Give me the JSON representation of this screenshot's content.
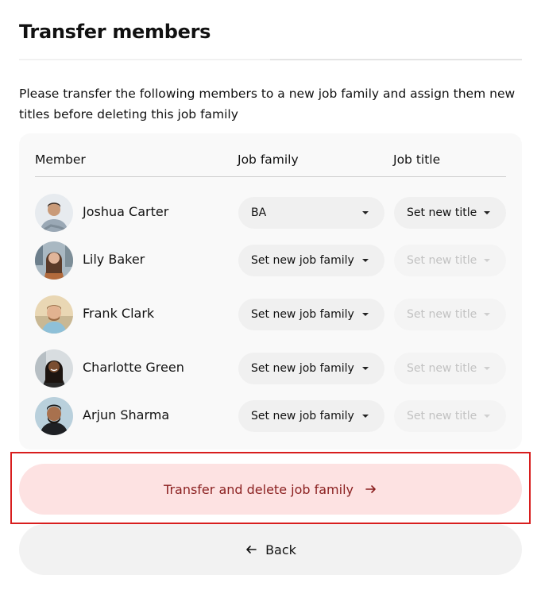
{
  "dialog": {
    "title": "Transfer members",
    "description": "Please transfer the following members to a new job family and assign them new titles before deleting this job family"
  },
  "table": {
    "headers": {
      "member": "Member",
      "job_family": "Job family",
      "job_title": "Job title"
    },
    "rows": [
      {
        "name": "Joshua Carter",
        "job_family": "BA",
        "job_title": "Set new title",
        "title_enabled": true
      },
      {
        "name": "Lily Baker",
        "job_family": "Set new job family",
        "job_title": "Set new title",
        "title_enabled": false
      },
      {
        "name": "Frank Clark",
        "job_family": "Set new job family",
        "job_title": "Set new title",
        "title_enabled": false
      },
      {
        "name": "Charlotte Green",
        "job_family": "Set new job family",
        "job_title": "Set new title",
        "title_enabled": false
      },
      {
        "name": "Arjun Sharma",
        "job_family": "Set new job family",
        "job_title": "Set new title",
        "title_enabled": false
      }
    ]
  },
  "actions": {
    "transfer_label": "Transfer and delete job family",
    "back_label": "Back"
  },
  "colors": {
    "primary_bg": "#fde2e2",
    "primary_text": "#8a1f1f",
    "highlight": "#d81e1e"
  },
  "icons": {
    "transfer": "arrow-right-icon",
    "back": "arrow-left-icon",
    "dropdown": "caret-down-icon"
  }
}
